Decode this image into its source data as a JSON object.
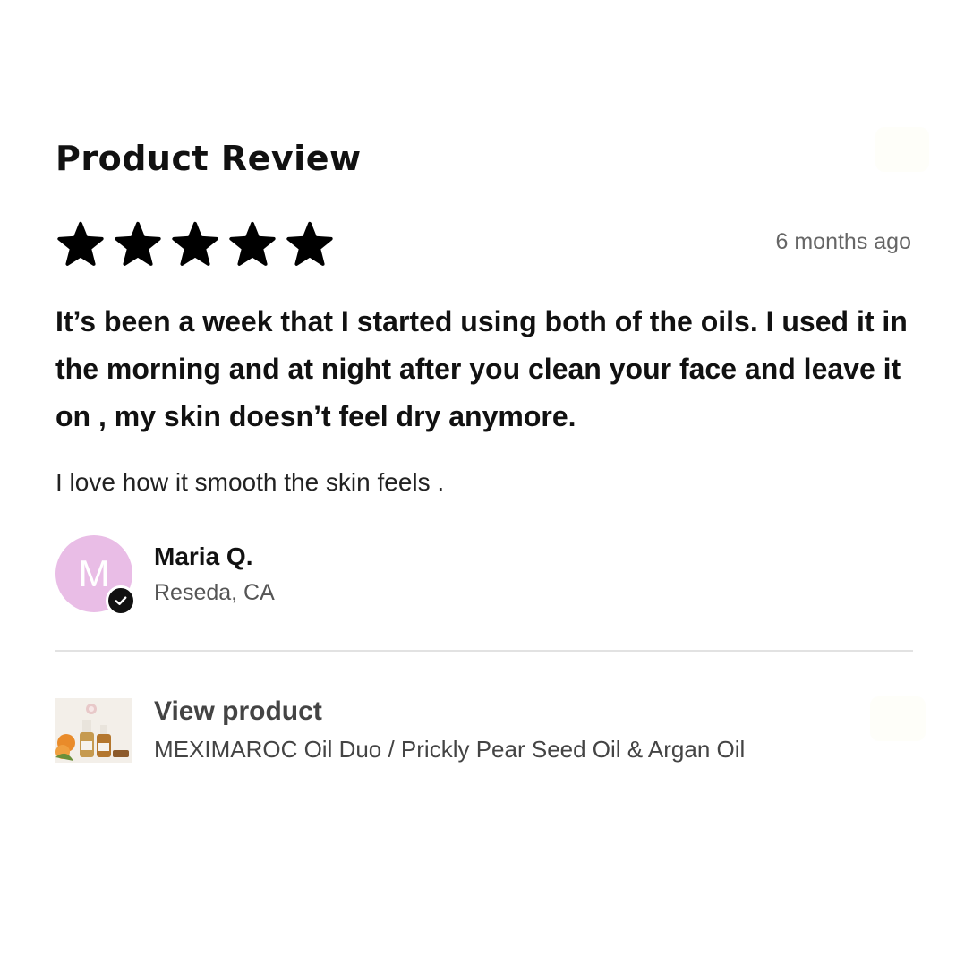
{
  "review": {
    "title": "Product Review",
    "rating": 5,
    "rating_max": 5,
    "date": "6 months ago",
    "headline": "It’s been a week that I started using both of the oils. I used it in the morning and at night after you clean your face and leave it on , my skin doesn’t feel dry anymore.",
    "body": "I love how it smooth the skin feels ."
  },
  "author": {
    "initial": "M",
    "name": "Maria Q.",
    "location": "Reseda, CA",
    "verified_icon": "check-circle-icon",
    "avatar_color": "#e9bde6"
  },
  "product": {
    "link_label": "View product",
    "name": "MEXIMAROC Oil Duo / Prickly Pear Seed Oil & Argan Oil"
  }
}
